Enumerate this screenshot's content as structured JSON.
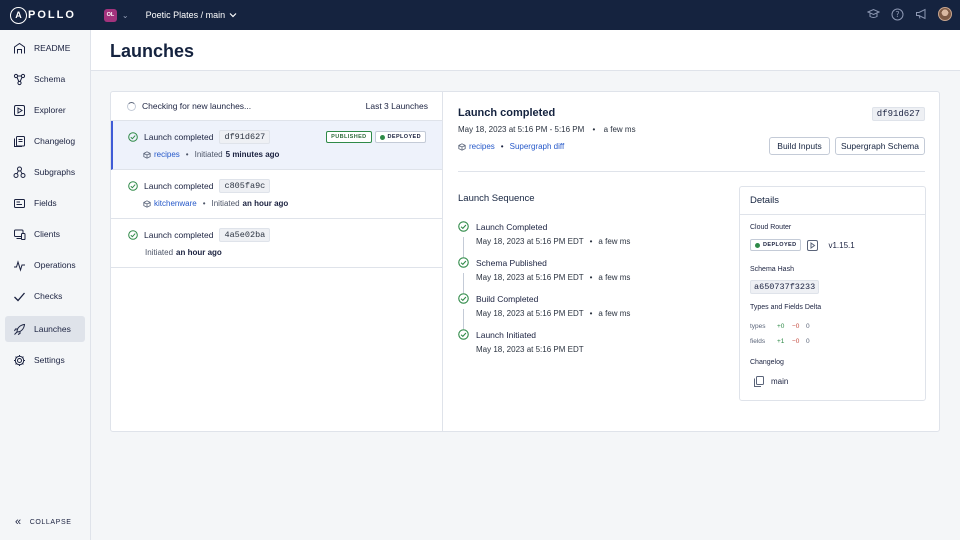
{
  "topbar": {
    "logo_mark": "A",
    "logo_text": "POLLO",
    "org_initials": "OL",
    "graph_name": "Poetic Plates / main"
  },
  "sidebar": {
    "items": [
      {
        "label": "README",
        "icon": "readme-icon"
      },
      {
        "label": "Schema",
        "icon": "schema-icon"
      },
      {
        "label": "Explorer",
        "icon": "explorer-icon"
      },
      {
        "label": "Changelog",
        "icon": "changelog-icon"
      },
      {
        "label": "Subgraphs",
        "icon": "subgraphs-icon"
      },
      {
        "label": "Fields",
        "icon": "fields-icon"
      },
      {
        "label": "Clients",
        "icon": "clients-icon"
      },
      {
        "label": "Operations",
        "icon": "operations-icon"
      },
      {
        "label": "Checks",
        "icon": "checks-icon"
      },
      {
        "label": "Launches",
        "icon": "launches-icon",
        "active": true
      },
      {
        "label": "Settings",
        "icon": "settings-icon"
      }
    ],
    "collapse_label": "COLLAPSE"
  },
  "page": {
    "title": "Launches"
  },
  "launch_list": {
    "status_text": "Checking for new launches...",
    "count_label": "Last 3 Launches",
    "items": [
      {
        "title": "Launch completed",
        "hash": "df91d627",
        "subgraph": "recipes",
        "initiated_label": "Initiated",
        "initiated_time": "5 minutes ago",
        "badges": [
          "PUBLISHED",
          "DEPLOYED"
        ]
      },
      {
        "title": "Launch completed",
        "hash": "c805fa9c",
        "subgraph": "kitchenware",
        "initiated_label": "Initiated",
        "initiated_time": "an hour ago"
      },
      {
        "title": "Launch completed",
        "hash": "4a5e02ba",
        "initiated_label": "Initiated",
        "initiated_time": "an hour ago"
      }
    ]
  },
  "detail": {
    "title": "Launch completed",
    "hash": "df91d627",
    "time_range": "May 18, 2023 at 5:16 PM - 5:16 PM",
    "time_ago": "a few ms",
    "subgraph_link": "recipes",
    "diff_link": "Supergraph diff",
    "build_inputs_label": "Build Inputs",
    "supergraph_schema_label": "Supergraph Schema",
    "sequence_title": "Launch Sequence",
    "sequence": [
      {
        "title": "Launch Completed",
        "time": "May 18, 2023 at 5:16 PM EDT",
        "ago": "a few ms"
      },
      {
        "title": "Schema Published",
        "time": "May 18, 2023 at 5:16 PM EDT",
        "ago": "a few ms"
      },
      {
        "title": "Build Completed",
        "time": "May 18, 2023 at 5:16 PM EDT",
        "ago": "a few ms"
      },
      {
        "title": "Launch Initiated",
        "time": "May 18, 2023 at 5:16 PM EDT",
        "ago": ""
      }
    ]
  },
  "details_card": {
    "title": "Details",
    "cloud_router_label": "Cloud Router",
    "deployed_badge": "DEPLOYED",
    "router_version": "v1.15.1",
    "schema_hash_label": "Schema Hash",
    "schema_hash": "a650737f3233",
    "delta_label": "Types and Fields Delta",
    "types": {
      "label": "types",
      "plus": "+0",
      "minus": "−0",
      "zero": "0"
    },
    "fields": {
      "label": "fields",
      "plus": "+1",
      "minus": "−0",
      "zero": "0"
    },
    "changelog_label": "Changelog",
    "changelog_value": "main"
  },
  "colors": {
    "topbar": "#15233f",
    "success": "#2f8a48",
    "link": "#2558c9",
    "selected_border": "#3f5bd6"
  }
}
